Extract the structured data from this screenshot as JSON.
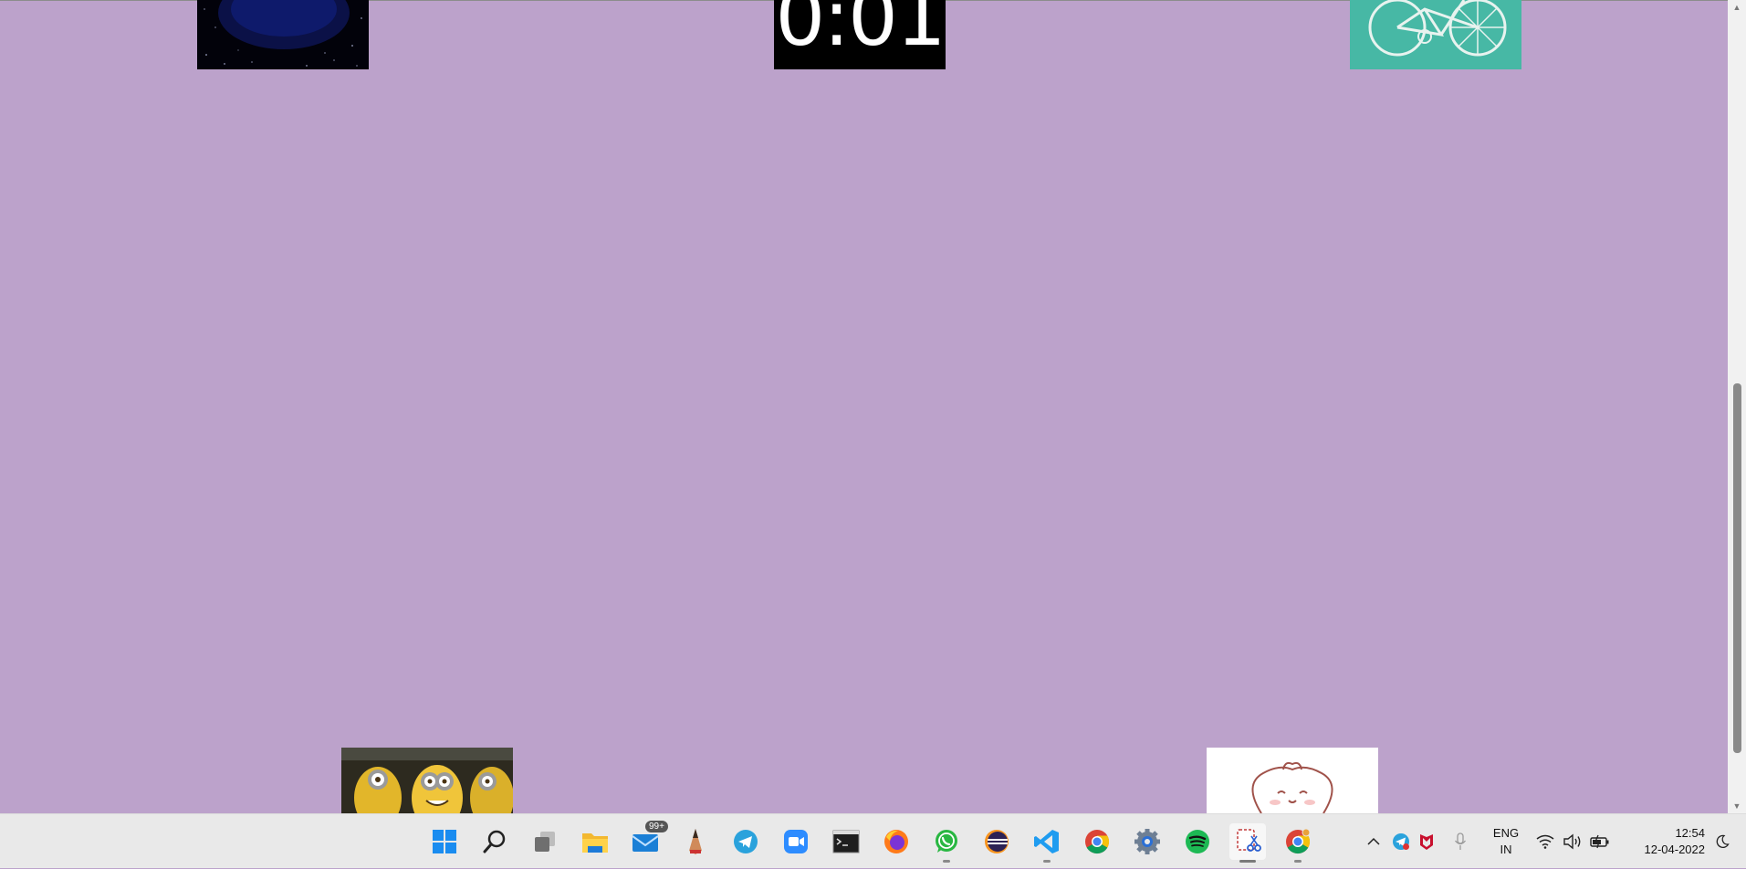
{
  "page": {
    "background_color": "#bca2cb"
  },
  "tiles": [
    {
      "name": "space-earth-thumbnail"
    },
    {
      "name": "countdown-timer-thumbnail",
      "text": "0:01"
    },
    {
      "name": "bicycle-thumbnail"
    },
    {
      "name": "minions-thumbnail"
    },
    {
      "name": "bunny-thumbnail"
    }
  ],
  "taskbar": {
    "apps": [
      {
        "name": "start-button",
        "icon": "windows-logo-icon"
      },
      {
        "name": "search-button",
        "icon": "search-icon"
      },
      {
        "name": "task-view-button",
        "icon": "task-view-icon"
      },
      {
        "name": "file-explorer-button",
        "icon": "folder-icon"
      },
      {
        "name": "mail-button",
        "icon": "mail-icon",
        "badge": "99+"
      },
      {
        "name": "pencil-app-button",
        "icon": "pencil-icon"
      },
      {
        "name": "telegram-button",
        "icon": "telegram-icon"
      },
      {
        "name": "zoom-button",
        "icon": "video-camera-icon"
      },
      {
        "name": "terminal-button",
        "icon": "terminal-icon"
      },
      {
        "name": "firefox-button",
        "icon": "firefox-icon"
      },
      {
        "name": "whatsapp-button",
        "icon": "whatsapp-icon"
      },
      {
        "name": "eclipse-button",
        "icon": "eclipse-icon"
      },
      {
        "name": "vscode-button",
        "icon": "vscode-icon"
      },
      {
        "name": "chrome-button",
        "icon": "chrome-icon"
      },
      {
        "name": "settings-button",
        "icon": "gear-icon"
      },
      {
        "name": "spotify-button",
        "icon": "spotify-icon"
      },
      {
        "name": "snipping-tool-button",
        "icon": "snipping-tool-icon"
      },
      {
        "name": "chrome-profile-button",
        "icon": "chrome-icon"
      }
    ],
    "tray": {
      "language_line1": "ENG",
      "language_line2": "IN",
      "time": "12:54",
      "date": "12-04-2022"
    }
  }
}
